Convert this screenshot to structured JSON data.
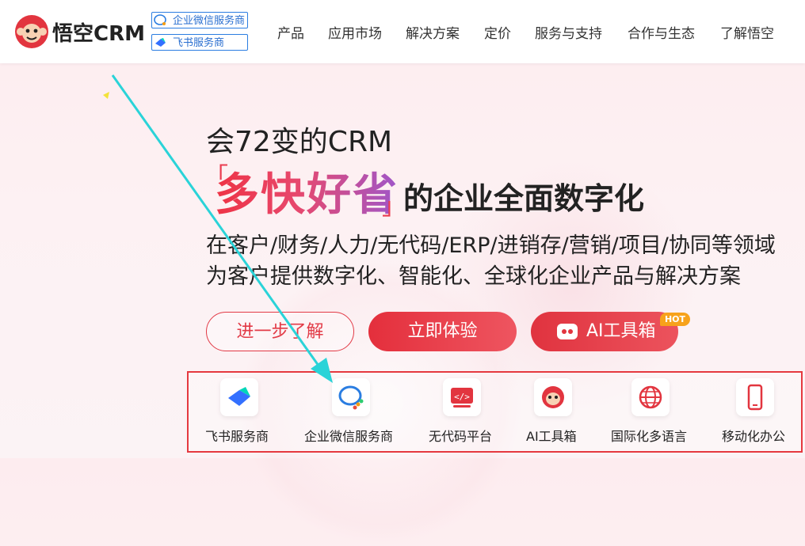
{
  "brand": {
    "name": "悟空CRM"
  },
  "badges": [
    {
      "label": "企业微信服务商"
    },
    {
      "label": "飞书服务商"
    }
  ],
  "nav": [
    {
      "label": "产品"
    },
    {
      "label": "应用市场"
    },
    {
      "label": "解决方案"
    },
    {
      "label": "定价"
    },
    {
      "label": "服务与支持"
    },
    {
      "label": "合作与生态"
    },
    {
      "label": "了解悟空"
    }
  ],
  "hero": {
    "line1": "会72变的CRM",
    "accent": "多快好省",
    "rest": "的企业全面数字化",
    "desc1": "在客户/财务/人力/无代码/ERP/进销存/营销/项目/协同等领域",
    "desc2": "为客户提供数字化、智能化、全球化企业产品与解决方案"
  },
  "buttons": {
    "learn_more": "进一步了解",
    "try_now": "立即体验",
    "ai_toolbox": "AI工具箱",
    "hot": "HOT"
  },
  "features": [
    {
      "label": "飞书服务商",
      "icon": "feishu-icon"
    },
    {
      "label": "企业微信服务商",
      "icon": "wecom-icon"
    },
    {
      "label": "无代码平台",
      "icon": "code-icon"
    },
    {
      "label": "AI工具箱",
      "icon": "ai-robot-icon"
    },
    {
      "label": "国际化多语言",
      "icon": "globe-icon"
    },
    {
      "label": "移动化办公",
      "icon": "mobile-icon"
    }
  ],
  "colors": {
    "primary": "#e42f3c",
    "badge_blue": "#2a7de1",
    "annotation_arrow": "#2ad3d8",
    "highlight_box": "#e5393f",
    "hot_badge": "#f7a21b"
  }
}
